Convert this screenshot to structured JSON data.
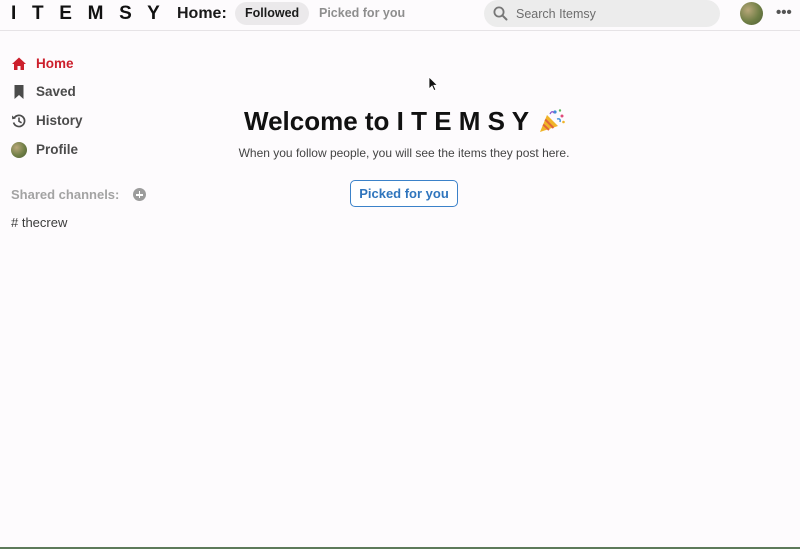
{
  "header": {
    "logo": "I T E M S Y",
    "home_label": "Home:",
    "tabs": [
      {
        "label": "Followed",
        "active": true
      },
      {
        "label": "Picked for you",
        "active": false
      }
    ],
    "search": {
      "placeholder": "Search Itemsy",
      "value": ""
    },
    "more_label": "•••"
  },
  "sidebar": {
    "items": [
      {
        "label": "Home",
        "icon": "home-icon",
        "active": true
      },
      {
        "label": "Saved",
        "icon": "bookmark-icon",
        "active": false
      },
      {
        "label": "History",
        "icon": "history-icon",
        "active": false
      },
      {
        "label": "Profile",
        "icon": "avatar",
        "active": false
      }
    ],
    "shared_channels_label": "Shared channels:",
    "channels": [
      {
        "label": "# thecrew"
      }
    ]
  },
  "main": {
    "welcome_title": "Welcome to I T E M S Y",
    "subtitle": "When you follow people, you will see the items they post here.",
    "button_label": "Picked for you"
  },
  "colors": {
    "accent_red": "#cc1f2c",
    "link_blue": "#2f75bd",
    "background": "#fdfbfd"
  }
}
